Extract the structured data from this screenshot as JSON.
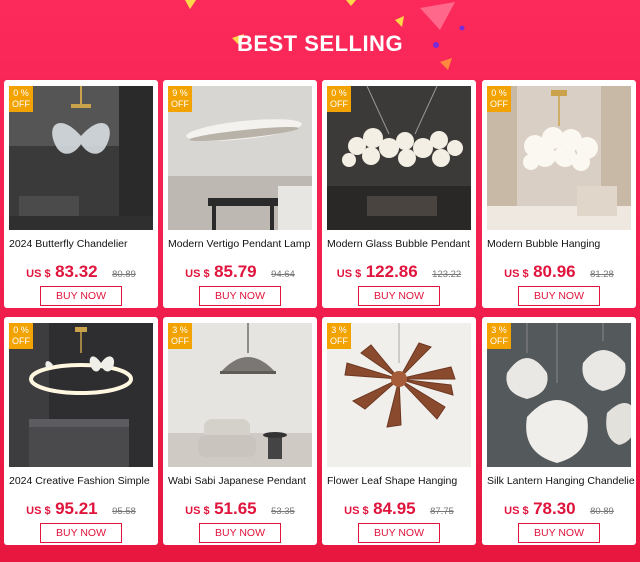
{
  "header": {
    "title": "BEST SELLING"
  },
  "colors": {
    "background": "#f21f4f",
    "accent": "#e0143c",
    "badge": "#f2a300"
  },
  "products": [
    {
      "discount": "0 %",
      "off": "OFF",
      "name": "2024 Butterfly Chandelier",
      "currency": "US $",
      "price": "83.32",
      "old_price": "80.89",
      "button": "BUY NOW"
    },
    {
      "discount": "9 %",
      "off": "OFF",
      "name": "Modern Vertigo Pendant Lamp",
      "currency": "US $",
      "price": "85.79",
      "old_price": "94.64",
      "button": "BUY NOW"
    },
    {
      "discount": "0 %",
      "off": "OFF",
      "name": "Modern Glass Bubble Pendant",
      "currency": "US $",
      "price": "122.86",
      "old_price": "123.22",
      "button": "BUY NOW"
    },
    {
      "discount": "0 %",
      "off": "OFF",
      "name": "Modern Bubble Hanging",
      "currency": "US $",
      "price": "80.96",
      "old_price": "81.28",
      "button": "BUY NOW"
    },
    {
      "discount": "0 %",
      "off": "OFF",
      "name": "2024 Creative Fashion Simple",
      "currency": "US $",
      "price": "95.21",
      "old_price": "95.58",
      "button": "BUY NOW"
    },
    {
      "discount": "3 %",
      "off": "OFF",
      "name": "Wabi Sabi Japanese Pendant",
      "currency": "US $",
      "price": "51.65",
      "old_price": "53.35",
      "button": "BUY NOW"
    },
    {
      "discount": "3 %",
      "off": "OFF",
      "name": "Flower Leaf Shape Hanging",
      "currency": "US $",
      "price": "84.95",
      "old_price": "87.75",
      "button": "BUY NOW"
    },
    {
      "discount": "3 %",
      "off": "OFF",
      "name": "Silk Lantern Hanging Chandelier",
      "currency": "US $",
      "price": "78.30",
      "old_price": "80.89",
      "button": "BUY NOW"
    }
  ]
}
